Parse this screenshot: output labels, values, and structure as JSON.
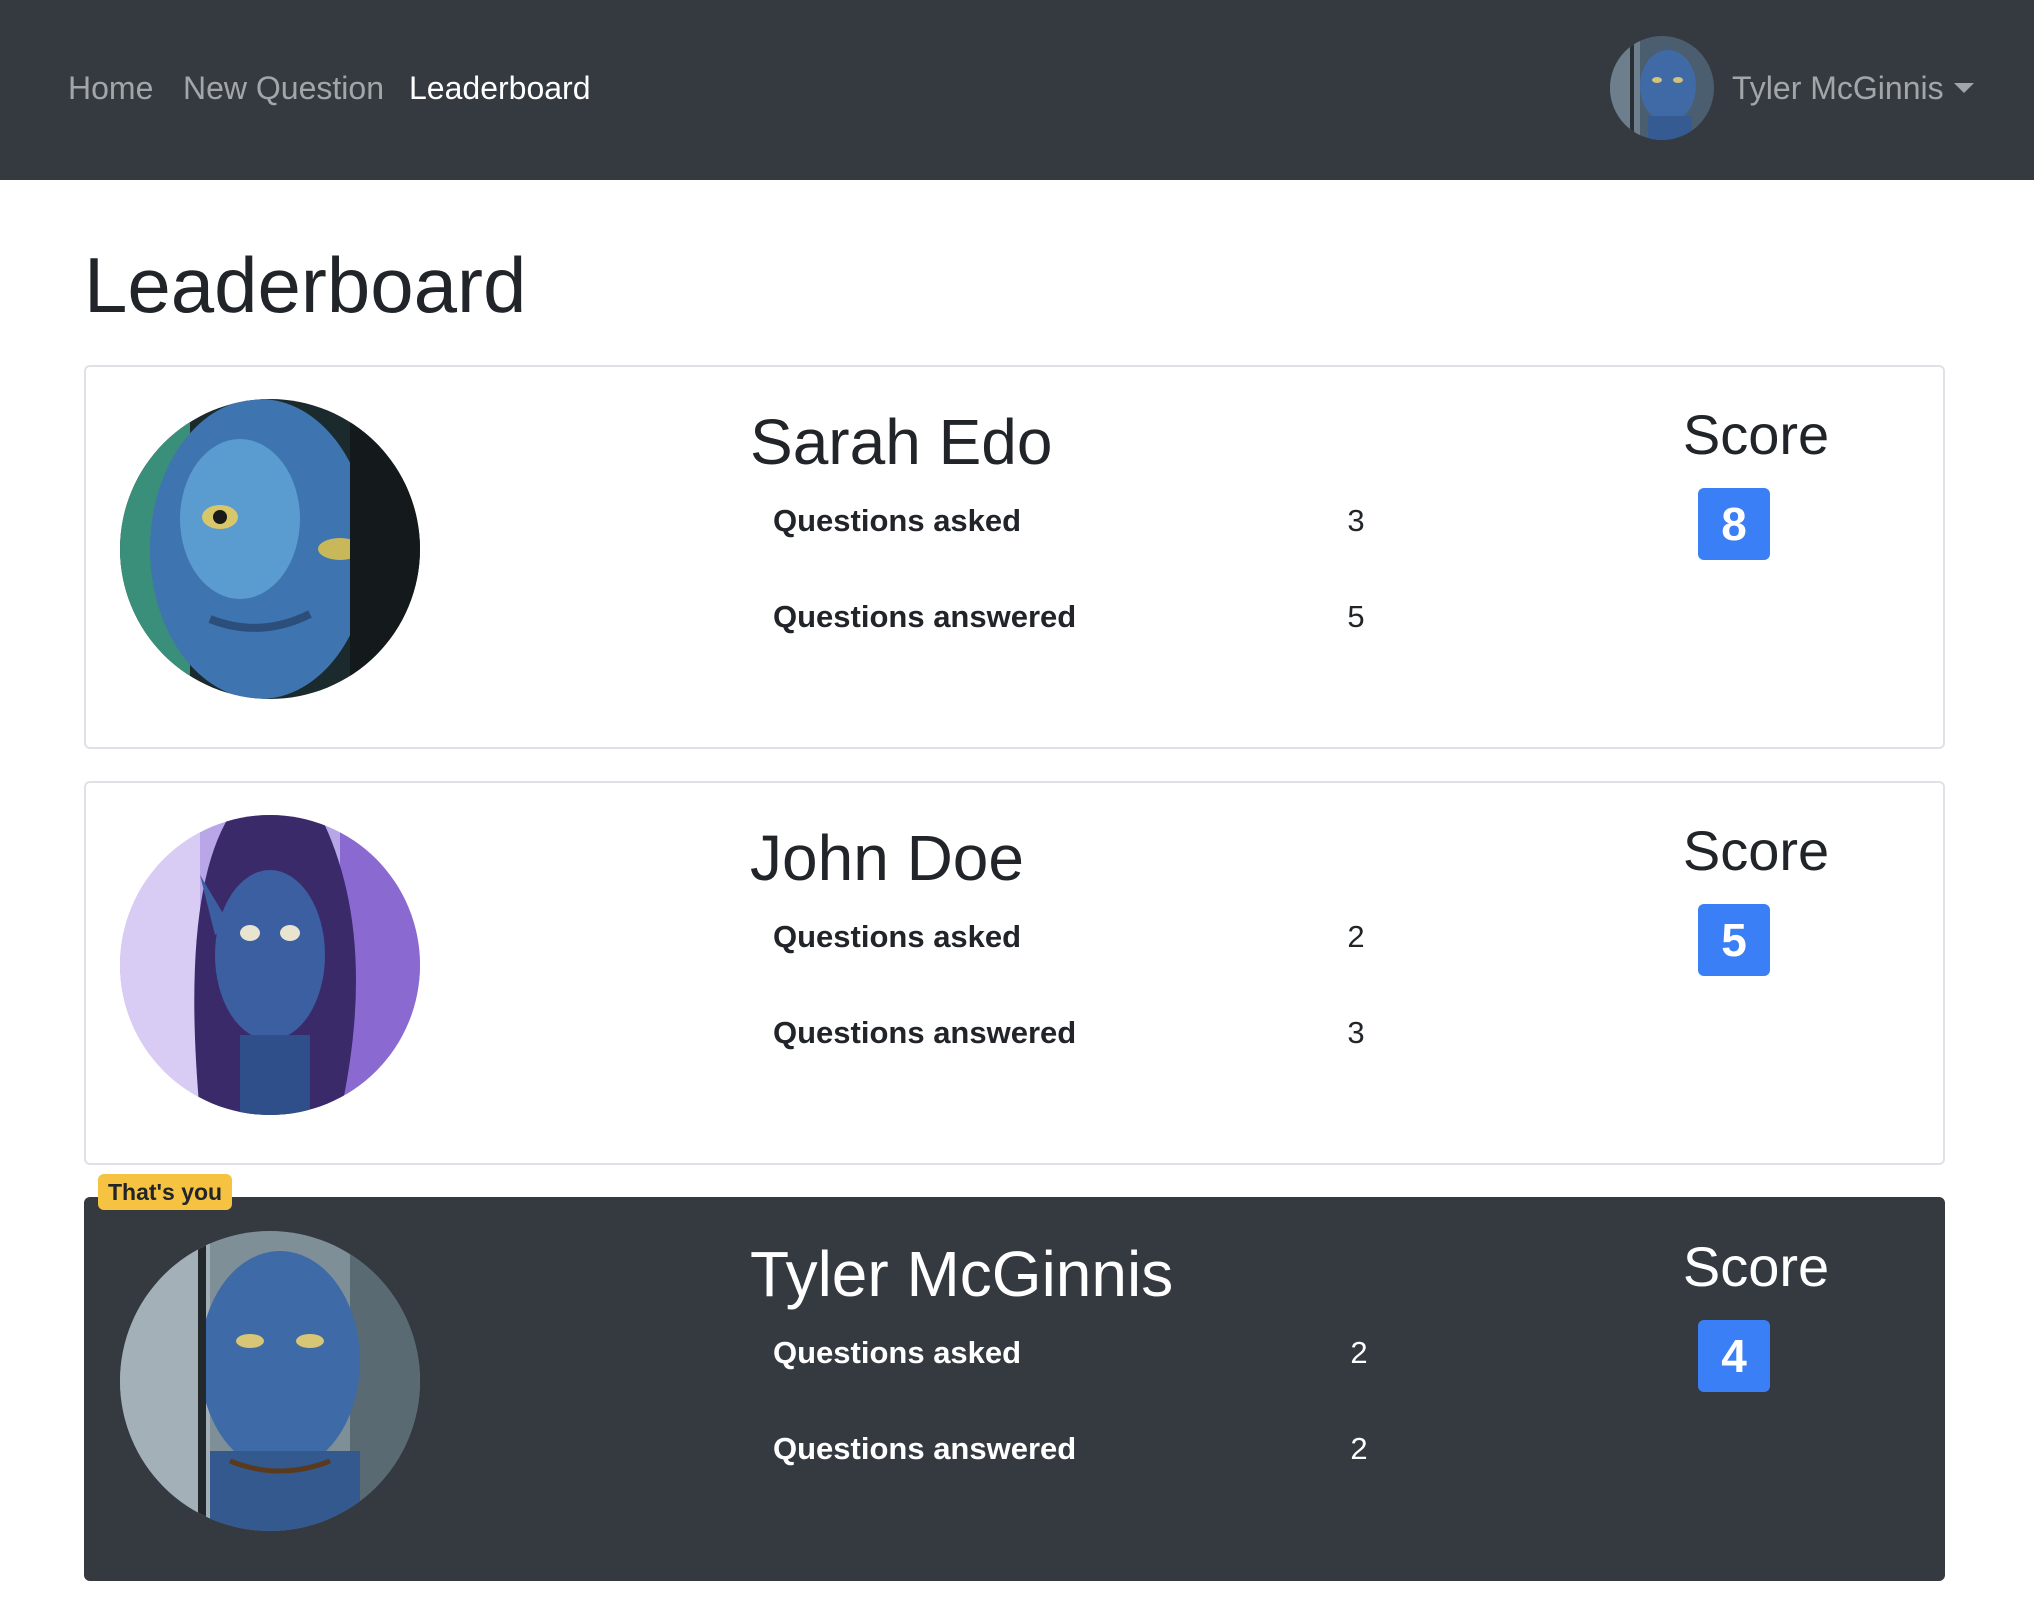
{
  "nav": {
    "links": [
      {
        "label": "Home",
        "active": false
      },
      {
        "label": "New Question",
        "active": false
      },
      {
        "label": "Leaderboard",
        "active": true
      }
    ],
    "user_name": "Tyler McGinnis"
  },
  "page": {
    "title": "Leaderboard"
  },
  "leaderboard": [
    {
      "name": "Sarah Edo",
      "asked_label": "Questions asked",
      "asked": "3",
      "answered_label": "Questions answered",
      "answered": "5",
      "score_label": "Score",
      "score": "8",
      "is_current_user": false
    },
    {
      "name": "John Doe",
      "asked_label": "Questions asked",
      "asked": "2",
      "answered_label": "Questions answered",
      "answered": "3",
      "score_label": "Score",
      "score": "5",
      "is_current_user": false
    },
    {
      "name": "Tyler McGinnis",
      "asked_label": "Questions asked",
      "asked": "2",
      "answered_label": "Questions answered",
      "answered": "2",
      "score_label": "Score",
      "score": "4",
      "is_current_user": true
    }
  ],
  "current_user_badge": "That's you",
  "colors": {
    "navbar": "#343a40",
    "score_badge": "#3a7ff6",
    "you_badge": "#f5c242",
    "highlight_card": "#343a40"
  }
}
